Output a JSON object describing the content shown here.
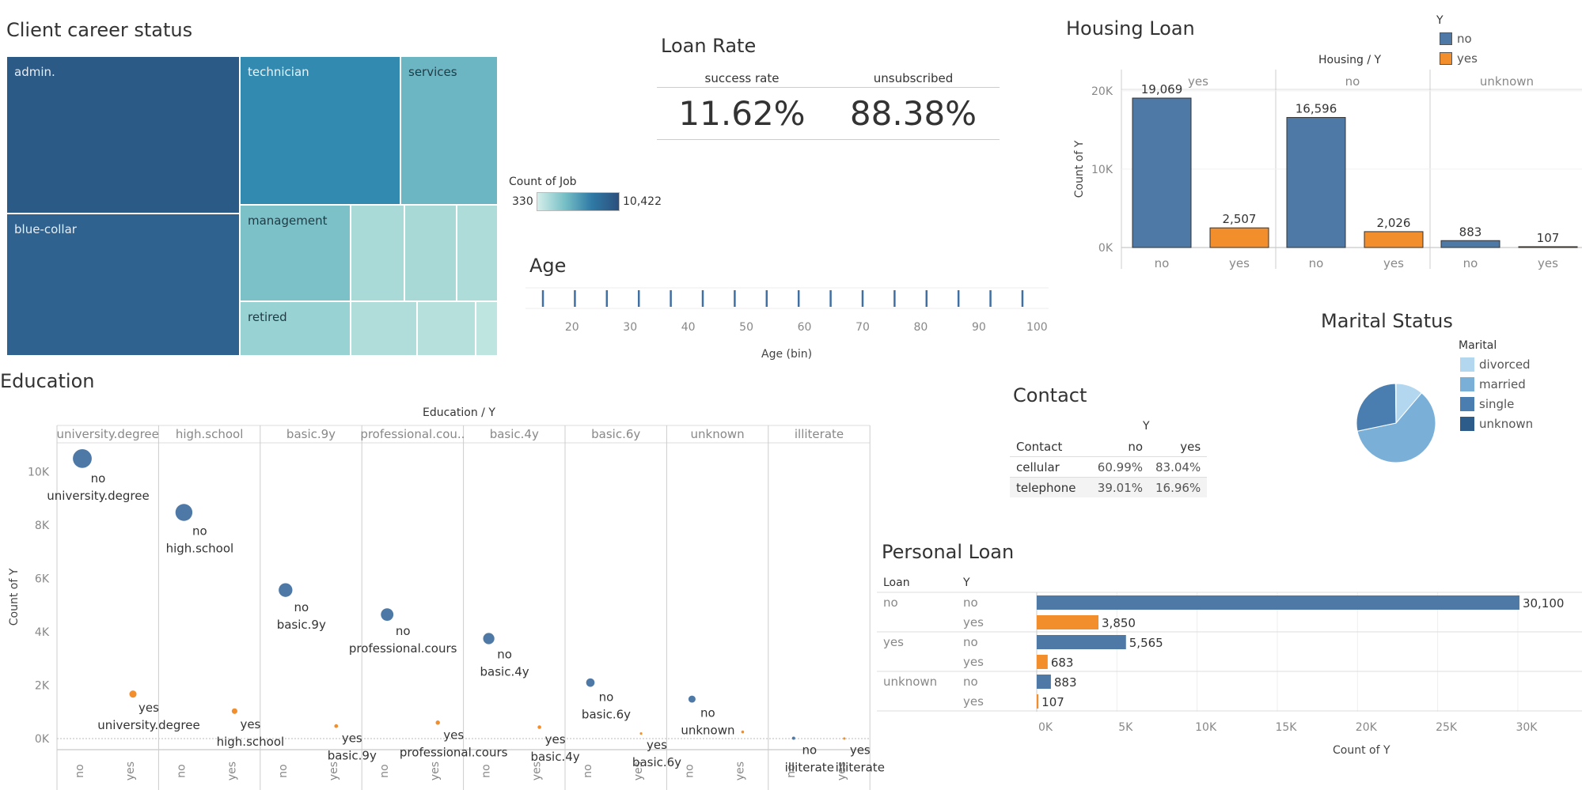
{
  "career": {
    "title": "Client career status",
    "legend_title": "Count of Job",
    "legend_min": "330",
    "legend_max": "10,422",
    "tiles": [
      {
        "label": "admin.",
        "color": "#2c5a86",
        "text": "#e8eef5"
      },
      {
        "label": "blue-collar",
        "color": "#30628f",
        "text": "#e8eef5"
      },
      {
        "label": "technician",
        "color": "#338ab0",
        "text": "#eaf4f8"
      },
      {
        "label": "services",
        "color": "#6cb6c4",
        "text": "#1f3b44"
      },
      {
        "label": "management",
        "color": "#7cc1c8",
        "text": "#1f3b44"
      },
      {
        "label": "retired",
        "color": "#98d2d2",
        "text": "#1f3b44"
      },
      {
        "label": "",
        "color": "#a9dad7"
      },
      {
        "label": "",
        "color": "#a8d9d6"
      },
      {
        "label": "",
        "color": "#aeddd9"
      },
      {
        "label": "",
        "color": "#b0ddd9"
      },
      {
        "label": "",
        "color": "#b5e0dc"
      },
      {
        "label": "",
        "color": "#bfe5e0"
      }
    ]
  },
  "loan_rate": {
    "title": "Loan Rate",
    "success_label": "success rate",
    "success_value": "11.62%",
    "unsub_label": "unsubscribed",
    "unsub_value": "88.38%"
  },
  "age": {
    "title": "Age",
    "xlabel": "Age (bin)",
    "ticks": [
      "20",
      "30",
      "40",
      "50",
      "60",
      "70",
      "80",
      "90",
      "100"
    ]
  },
  "housing": {
    "title": "Housing Loan",
    "header": "Housing / Y",
    "ylabel": "Count of Y",
    "legend_title": "Y",
    "legend": [
      {
        "label": "no",
        "color": "#4e79a7"
      },
      {
        "label": "yes",
        "color": "#f28e2b"
      }
    ],
    "yticks": [
      "20K",
      "10K",
      "0K"
    ]
  },
  "marital": {
    "title": "Marital Status",
    "legend_title": "Marital",
    "legend": [
      {
        "label": "divorced",
        "color": "#b3d7ef"
      },
      {
        "label": "married",
        "color": "#7aafd8"
      },
      {
        "label": "single",
        "color": "#4a7eb0"
      },
      {
        "label": "unknown",
        "color": "#2d5b8a"
      }
    ]
  },
  "contact": {
    "title": "Contact",
    "col_header": "Y",
    "row_header": "Contact",
    "cols": [
      "no",
      "yes"
    ],
    "rows": [
      {
        "label": "cellular",
        "no": "60.99%",
        "yes": "83.04%"
      },
      {
        "label": "telephone",
        "no": "39.01%",
        "yes": "16.96%"
      }
    ]
  },
  "education": {
    "title": "Education",
    "header": "Education / Y",
    "ylabel": "Count of Y",
    "yticks": [
      "10K",
      "8K",
      "6K",
      "4K",
      "2K",
      "0K"
    ],
    "xlabels": [
      "no",
      "yes"
    ]
  },
  "personal": {
    "title": "Personal Loan",
    "col_loan": "Loan",
    "col_y": "Y",
    "xlabel": "Count of Y",
    "xticks": [
      "0K",
      "5K",
      "10K",
      "15K",
      "20K",
      "25K",
      "30K"
    ]
  },
  "chart_data": [
    {
      "type": "bar",
      "name": "Housing Loan",
      "title": "Housing Loan",
      "ylabel": "Count of Y",
      "ylim": [
        0,
        22000
      ],
      "facet_label": "Housing / Y",
      "facets": [
        "yes",
        "no",
        "unknown"
      ],
      "categories": [
        "no",
        "yes"
      ],
      "series": [
        {
          "facet": "yes",
          "values": [
            19069,
            2507
          ],
          "labels": [
            "19,069",
            "2,507"
          ]
        },
        {
          "facet": "no",
          "values": [
            16596,
            2026
          ],
          "labels": [
            "16,596",
            "2,026"
          ]
        },
        {
          "facet": "unknown",
          "values": [
            883,
            107
          ],
          "labels": [
            "883",
            "107"
          ]
        }
      ]
    },
    {
      "type": "pie",
      "title": "Marital Status",
      "categories": [
        "divorced",
        "married",
        "single",
        "unknown"
      ],
      "values": [
        11.2,
        60.5,
        28.1,
        0.2
      ]
    },
    {
      "type": "bar",
      "title": "Personal Loan",
      "orientation": "horizontal",
      "xlabel": "Count of Y",
      "xlim": [
        0,
        34000
      ],
      "rows": [
        {
          "loan": "no",
          "y": "no",
          "value": 30100,
          "label": "30,100"
        },
        {
          "loan": "",
          "y": "yes",
          "value": 3850,
          "label": "3,850"
        },
        {
          "loan": "yes",
          "y": "no",
          "value": 5565,
          "label": "5,565"
        },
        {
          "loan": "",
          "y": "yes",
          "value": 683,
          "label": "683"
        },
        {
          "loan": "unknown",
          "y": "no",
          "value": 883,
          "label": "883"
        },
        {
          "loan": "",
          "y": "yes",
          "value": 107,
          "label": "107"
        }
      ]
    },
    {
      "type": "scatter",
      "title": "Education",
      "ylabel": "Count of Y",
      "ylim": [
        0,
        11000
      ],
      "facet_label": "Education / Y",
      "facets": [
        "university.degree",
        "high.school",
        "basic.9y",
        "professional.cou..",
        "basic.4y",
        "basic.6y",
        "unknown",
        "illiterate"
      ],
      "points": [
        {
          "facet": 0,
          "y": "no",
          "count": 10500,
          "label1": "no",
          "label2": "university.degree"
        },
        {
          "facet": 0,
          "y": "yes",
          "count": 1670,
          "label1": "yes",
          "label2": "university.degree"
        },
        {
          "facet": 1,
          "y": "no",
          "count": 8480,
          "label1": "no",
          "label2": "high.school"
        },
        {
          "facet": 1,
          "y": "yes",
          "count": 1030,
          "label1": "yes",
          "label2": "high.school"
        },
        {
          "facet": 2,
          "y": "no",
          "count": 5570,
          "label1": "no",
          "label2": "basic.9y"
        },
        {
          "facet": 2,
          "y": "yes",
          "count": 470,
          "label1": "yes",
          "label2": "basic.9y"
        },
        {
          "facet": 3,
          "y": "no",
          "count": 4650,
          "label1": "no",
          "label2": "professional.cours"
        },
        {
          "facet": 3,
          "y": "yes",
          "count": 600,
          "label1": "yes",
          "label2": "professional.cours"
        },
        {
          "facet": 4,
          "y": "no",
          "count": 3750,
          "label1": "no",
          "label2": "basic.4y"
        },
        {
          "facet": 4,
          "y": "yes",
          "count": 430,
          "label1": "yes",
          "label2": "basic.4y"
        },
        {
          "facet": 5,
          "y": "no",
          "count": 2100,
          "label1": "no",
          "label2": "basic.6y"
        },
        {
          "facet": 5,
          "y": "yes",
          "count": 190,
          "label1": "yes",
          "label2": "basic.6y"
        },
        {
          "facet": 6,
          "y": "no",
          "count": 1480,
          "label1": "no",
          "label2": "unknown"
        },
        {
          "facet": 6,
          "y": "yes",
          "count": 250,
          "label1": "",
          "label2": ""
        },
        {
          "facet": 7,
          "y": "no",
          "count": 14,
          "label1": "no",
          "label2": "illiterate"
        },
        {
          "facet": 7,
          "y": "yes",
          "count": 4,
          "label1": "yes",
          "label2": "illiterate"
        }
      ]
    },
    {
      "type": "scatter",
      "title": "Age",
      "xlabel": "Age (bin)",
      "xlim": [
        12,
        102
      ],
      "x": [
        15,
        20.5,
        26,
        31.5,
        37,
        42.5,
        48,
        53.5,
        59,
        64.5,
        70,
        75.5,
        81,
        86.5,
        92,
        97.5
      ]
    }
  ]
}
